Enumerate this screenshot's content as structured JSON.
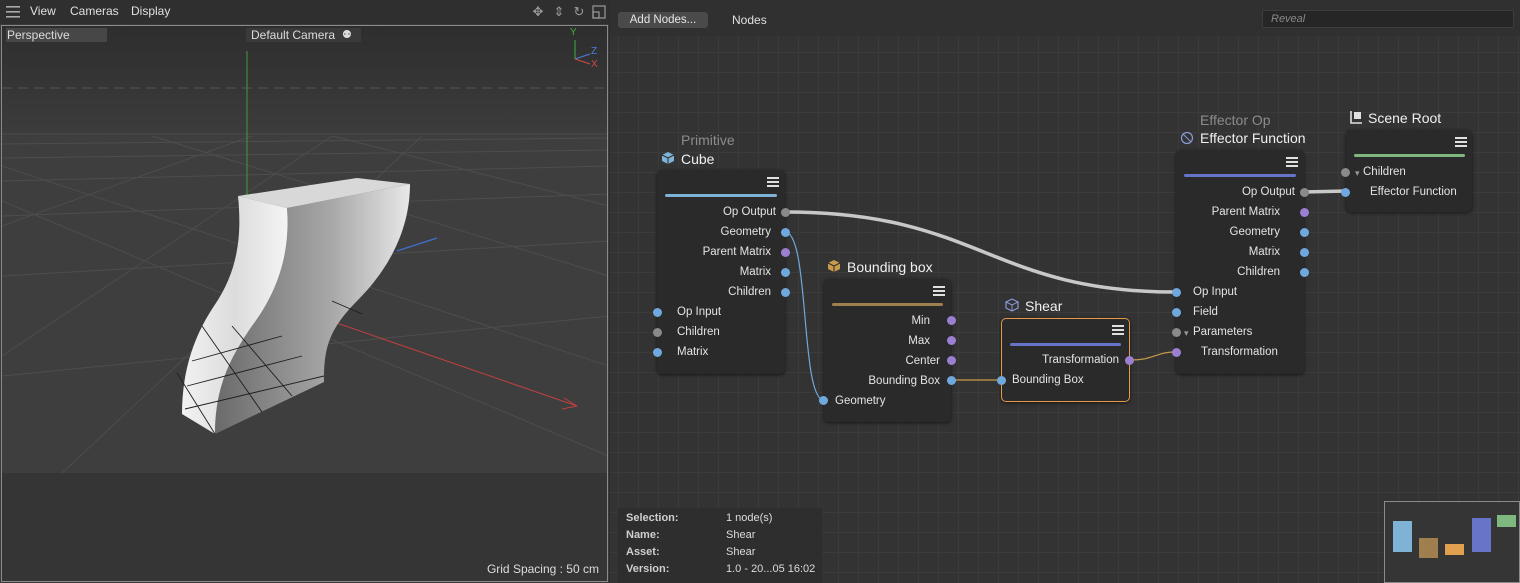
{
  "viewport": {
    "menu": {
      "view": "View",
      "cameras": "Cameras",
      "display": "Display"
    },
    "labels": {
      "projection": "Perspective",
      "camera": "Default Camera",
      "grid_spacing": "Grid Spacing : 50 cm"
    },
    "axes": {
      "y": "Y",
      "z": "Z",
      "x": "X"
    },
    "tool_icons": [
      "move-view-icon",
      "dolly-view-icon",
      "rotate-view-icon",
      "maximize-view-icon"
    ]
  },
  "node_editor": {
    "toolbar": {
      "add_nodes": "Add Nodes...",
      "nodes": "Nodes",
      "reveal_placeholder": "Reveal"
    },
    "nodes": {
      "cube": {
        "subtitle": "Primitive",
        "title": "Cube",
        "color": "#7fb3d5",
        "outputs": [
          "Op Output",
          "Geometry",
          "Parent Matrix",
          "Matrix",
          "Children"
        ],
        "inputs": [
          "Op Input",
          "Children",
          "Matrix"
        ]
      },
      "bbox": {
        "title": "Bounding box",
        "color": "#a07f4e",
        "outputs": [
          "Min",
          "Max",
          "Center",
          "Bounding Box"
        ],
        "inputs": [
          "Geometry"
        ]
      },
      "shear": {
        "title": "Shear",
        "color": "#6675c8",
        "outputs": [
          "Transformation"
        ],
        "inputs": [
          "Bounding Box"
        ]
      },
      "effector": {
        "subtitle": "Effector Op",
        "title": "Effector Function",
        "color": "#6675c8",
        "outputs": [
          "Op Output",
          "Parent Matrix",
          "Geometry",
          "Matrix",
          "Children"
        ],
        "inputs": [
          "Op Input",
          "Field",
          "Parameters",
          "Transformation"
        ]
      },
      "scene_root": {
        "title": "Scene Root",
        "color": "#7fb87f",
        "inputs": [
          "Children",
          "Effector Function"
        ]
      }
    },
    "info": {
      "selection_key": "Selection:",
      "selection_val": "1 node(s)",
      "name_key": "Name:",
      "name_val": "Shear",
      "asset_key": "Asset:",
      "asset_val": "Shear",
      "version_key": "Version:",
      "version_val": "1.0 - 20...05 16:02"
    },
    "minimap_colors": [
      "#7fb3d5",
      "#a07f4e",
      "#e0a050",
      "#6675c8",
      "#7fb87f"
    ]
  },
  "colors": {
    "port_blue": "#6fa8dc",
    "port_purple": "#9b7fd0",
    "port_gray": "#8a8a8a",
    "selection_outline": "#e59a4c"
  }
}
